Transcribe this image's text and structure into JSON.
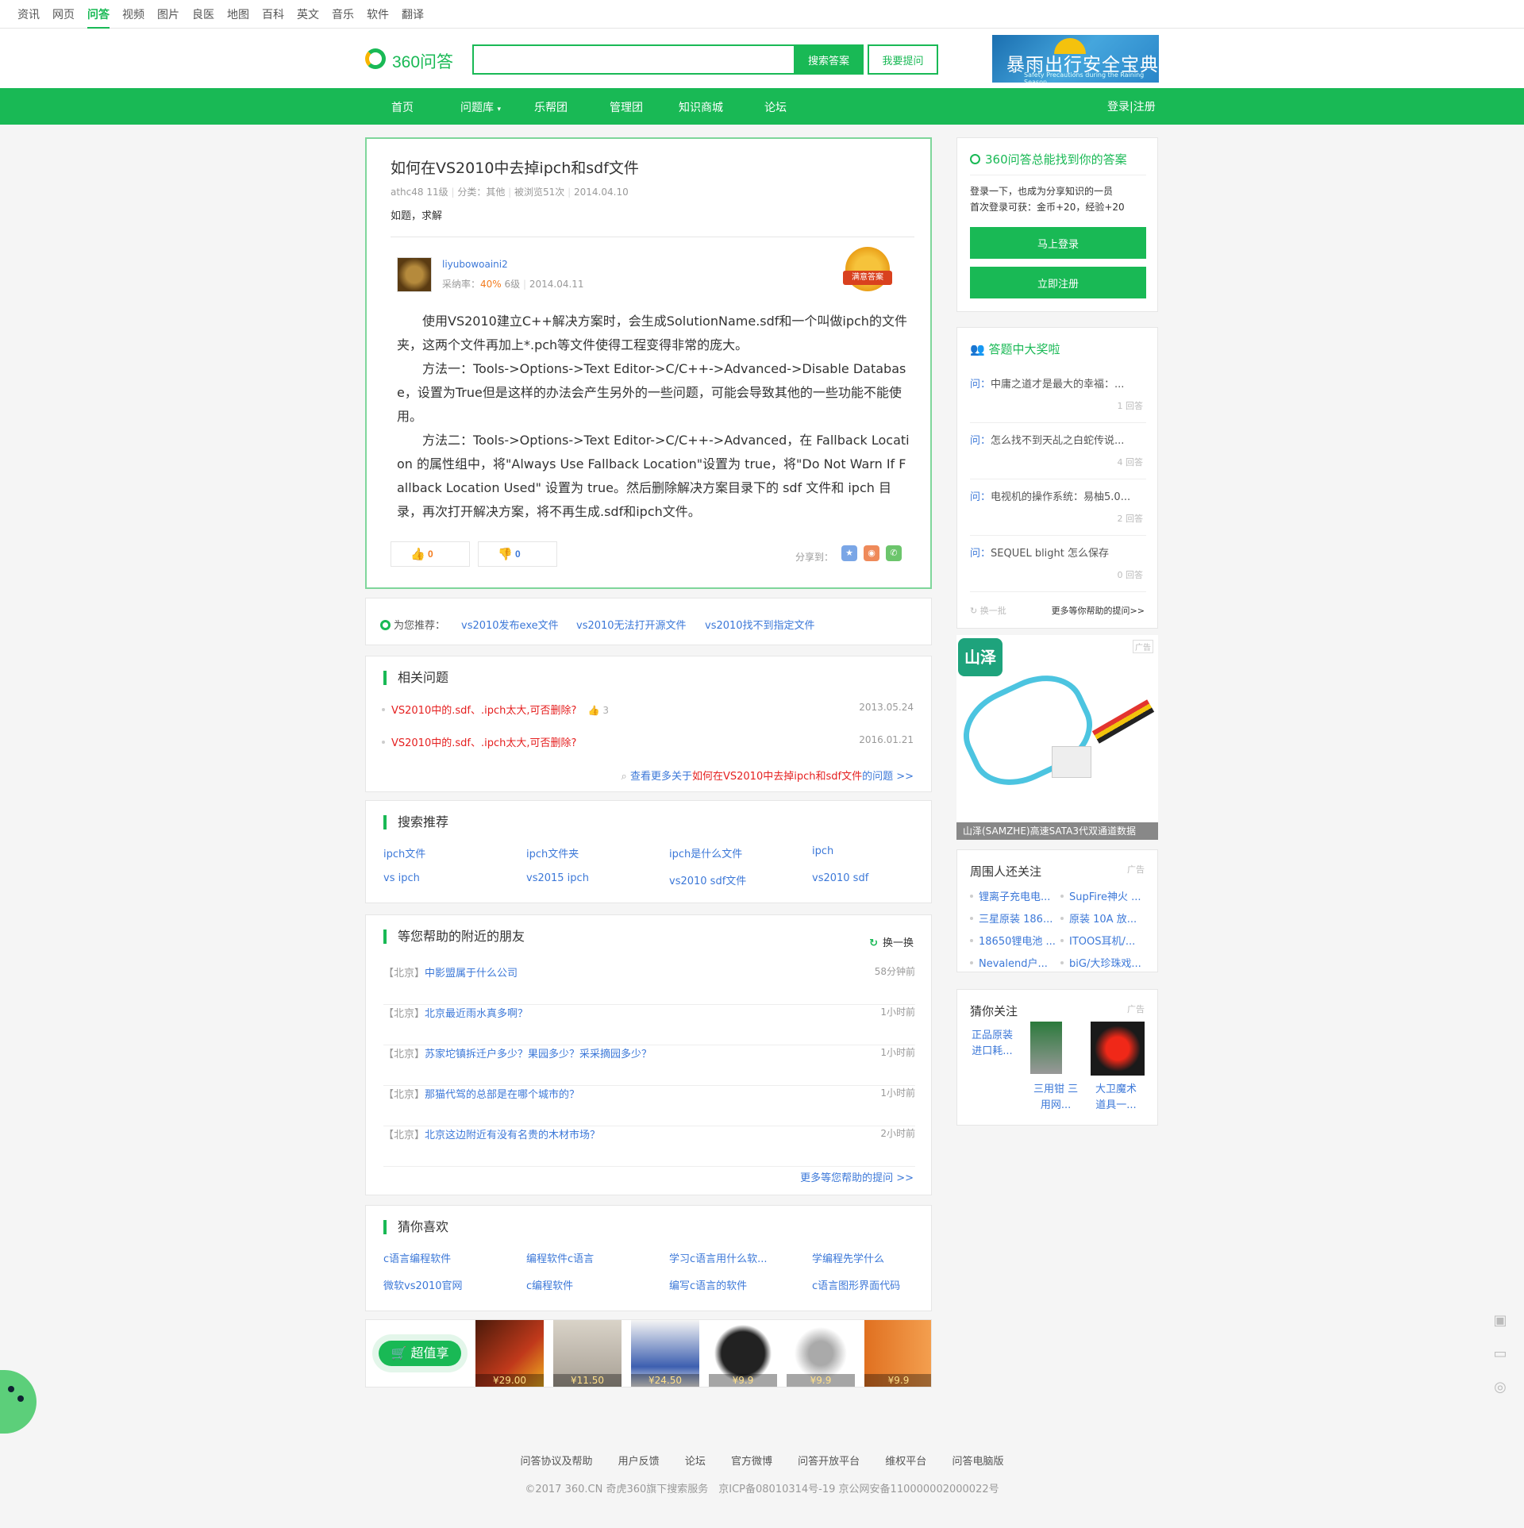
{
  "topnav": [
    "资讯",
    "网页",
    "问答",
    "视频",
    "图片",
    "良医",
    "地图",
    "百科",
    "英文",
    "音乐",
    "软件",
    "翻译"
  ],
  "header": {
    "logo_text": "360问答",
    "search_placeholder": "",
    "search_button": "搜索答案",
    "ask_button": "我要提问",
    "ad_title": "暴雨出行安全宝典",
    "ad_subtitle": "Safety Precautions during the Raining Season"
  },
  "greennav": {
    "items": [
      "首页",
      "问题库",
      "乐帮团",
      "管理团",
      "知识商城",
      "论坛"
    ],
    "login": "登录|注册"
  },
  "question": {
    "title": "如何在VS2010中去掉ipch和sdf文件",
    "user": "athc48",
    "level": "11级",
    "category": "分类：其他",
    "views": "被浏览51次",
    "date": "2014.04.10",
    "description": "如题，求解"
  },
  "answer": {
    "user": "liyubowoaini2",
    "accept_rate_label": "采纳率：",
    "accept_rate": "40%",
    "level": "6级",
    "date": "2014.04.11",
    "badge": "满意答案",
    "paragraphs": [
      "使用VS2010建立C++解决方案时，会生成SolutionName.sdf和一个叫做ipch的文件夹，这两个文件再加上*.pch等文件使得工程变得非常的庞大。",
      "方法一：Tools->Options->Text Editor->C/C++->Advanced->Disable Database，设置为True但是这样的办法会产生另外的一些问题，可能会导致其他的一些功能不能使用。",
      "方法二：Tools->Options->Text Editor->C/C++->Advanced，在 Fallback Location 的属性组中，将\"Always Use Fallback Location\"设置为 true，将\"Do Not Warn If Fallback Location Used\" 设置为 true。然后删除解决方案目录下的 sdf 文件和 ipch 目录，再次打开解决方案，将不再生成.sdf和ipch文件。"
    ],
    "upvotes": "0",
    "downvotes": "0",
    "share_label": "分享到："
  },
  "recommend": {
    "label": "为您推荐：",
    "links": [
      "vs2010发布exe文件",
      "vs2010无法打开源文件",
      "vs2010找不到指定文件"
    ]
  },
  "related": {
    "title": "相关问题",
    "items": [
      {
        "text": "VS2010中的.sdf、.ipch太大,可否删除?",
        "likes": "3",
        "date": "2013.05.24"
      },
      {
        "text": "VS2010中的.sdf、.ipch太大,可否删除?",
        "likes": "",
        "date": "2016.01.21"
      }
    ],
    "more_prefix": "查看更多关于",
    "more_highlight": "如何在VS2010中去掉ipch和sdf文件",
    "more_suffix": "的问题 >>"
  },
  "search_rec": {
    "title": "搜索推荐",
    "links": [
      "ipch文件",
      "ipch文件夹",
      "ipch是什么文件",
      "ipch",
      "vs ipch",
      "vs2015 ipch",
      "vs2010 sdf文件",
      "vs2010 sdf"
    ]
  },
  "nearby": {
    "title": "等您帮助的附近的朋友",
    "refresh": "换一换",
    "items": [
      {
        "loc": "【北京】",
        "q": "中影盟属于什么公司",
        "t": "58分钟前"
      },
      {
        "loc": "【北京】",
        "q": "北京最近雨水真多啊？",
        "t": "1小时前"
      },
      {
        "loc": "【北京】",
        "q": "苏家坨镇拆迁户多少？果园多少？采采摘园多少？",
        "t": "1小时前"
      },
      {
        "loc": "【北京】",
        "q": "那猫代驾的总部是在哪个城市的？",
        "t": "1小时前"
      },
      {
        "loc": "【北京】",
        "q": "北京这边附近有没有名贵的木材市场？",
        "t": "2小时前"
      }
    ],
    "more": "更多等您帮助的提问 >>"
  },
  "guess": {
    "title": "猜你喜欢",
    "links": [
      "c语言编程软件",
      "编程软件c语言",
      "学习c语言用什么软...",
      "学编程先学什么",
      "微软vs2010官网",
      "c编程软件",
      "编写c语言的软件",
      "c语言图形界面代码"
    ]
  },
  "shop": {
    "button": "超值享",
    "prices": [
      "¥29.00",
      "¥11.50",
      "¥24.50",
      "¥9.9",
      "¥9.9",
      "¥9.9"
    ]
  },
  "login_box": {
    "title": "360问答总能找到你的答案",
    "line1": "登录一下，也成为分享知识的一员",
    "line2": "首次登录可获：金币+20，经验+20",
    "login_button": "马上登录",
    "register_button": "立即注册"
  },
  "reward": {
    "title": "答题中大奖啦",
    "prefix": "问：",
    "items": [
      {
        "q": "中庸之道才是最大的幸福：...",
        "c": "1 回答"
      },
      {
        "q": "怎么找不到天乩之白蛇传说...",
        "c": "4 回答"
      },
      {
        "q": "电视机的操作系统：易柚5.0...",
        "c": "2 回答"
      },
      {
        "q": "SEQUEL blight 怎么保存",
        "c": "0 回答"
      }
    ],
    "refresh": "换一批",
    "more": "更多等你帮助的提问>>"
  },
  "side_ad": {
    "brand": "山泽",
    "tag": "广告",
    "caption": "山泽(SAMZHE)高速SATA3代双通道数据"
  },
  "around": {
    "title": "周围人还关注",
    "tag": "广告",
    "items": [
      "锂离子充电电...",
      "SupFire神火 ...",
      "三星原装 186...",
      "原装 10A 放...",
      "18650锂电池 ...",
      "ITOOS耳机/...",
      "Nevalend户...",
      "biG/大珍珠戏..."
    ]
  },
  "guesscare": {
    "title": "猜你关注",
    "tag": "广告",
    "item1": [
      "正品原装",
      "进口耗..."
    ],
    "item2": [
      "三用钳 三",
      "用网..."
    ],
    "item3": [
      "大卫魔术",
      "道具一..."
    ]
  },
  "footer": {
    "links": [
      "问答协议及帮助",
      "用户反馈",
      "论坛",
      "官方微博",
      "问答开放平台",
      "维权平台",
      "问答电脑版"
    ],
    "copyright": "©2017 360.CN 奇虎360旗下搜索服务　京ICP备08010314号-19 京公网安备110000002000022号"
  },
  "colors": {
    "brand": "#19b955",
    "link": "#3c78d8",
    "highlight": "#e52020"
  }
}
